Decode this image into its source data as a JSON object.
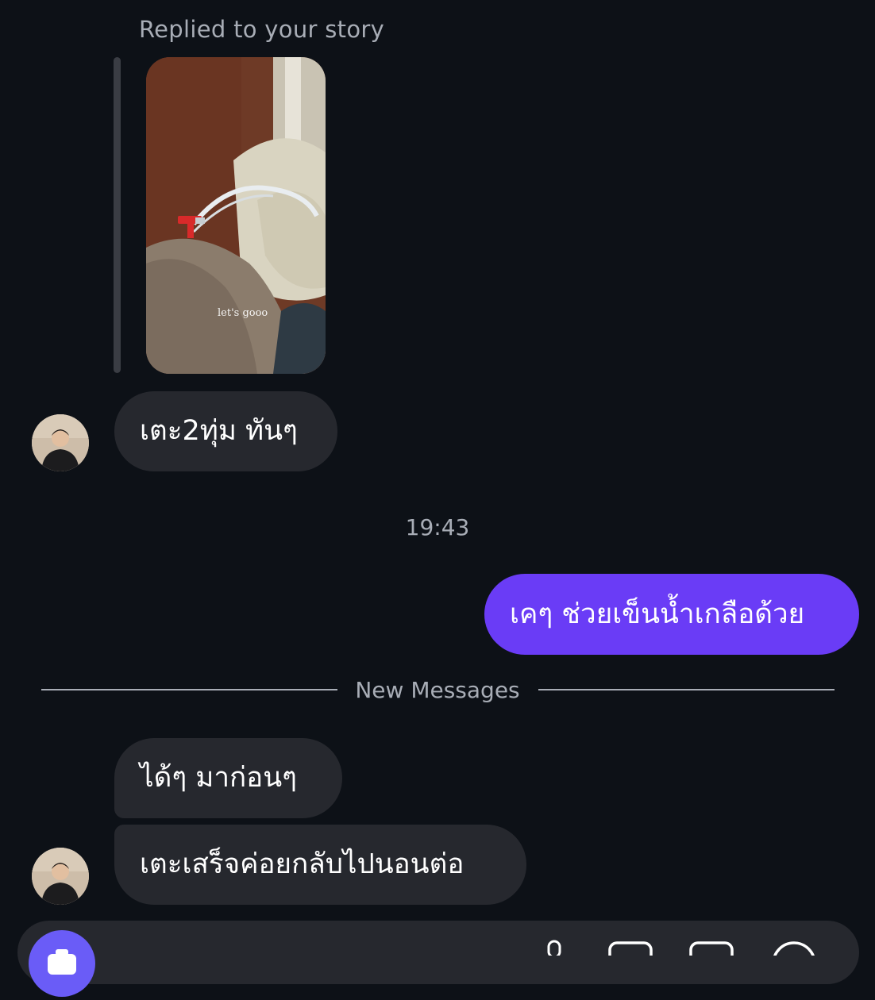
{
  "conversation": {
    "reply_label": "Replied to your story",
    "story": {
      "caption": "let's gooo"
    },
    "messages_before": [
      {
        "sender": "them",
        "text": "เตะ2ทุ่ม ทันๆ"
      }
    ],
    "timestamp": "19:43",
    "outgoing_message": "เคๆ ช่วยเข็นน้ำเกลือด้วย",
    "divider_label": "New Messages",
    "messages_after": [
      {
        "sender": "them",
        "text": "ได้ๆ มาก่อนๆ"
      },
      {
        "sender": "them",
        "text": "เตะเสร็จค่อยกลับไปนอนต่อ"
      }
    ]
  },
  "composer": {
    "camera_icon": "camera-icon",
    "icons": [
      "microphone-icon",
      "image-icon",
      "sticker-icon",
      "add-circle-icon"
    ]
  },
  "colors": {
    "background": "#0d1117",
    "incoming_bubble": "#26282e",
    "outgoing_bubble": "#6a3cf6",
    "secondary_text": "#a8adb6",
    "camera_button": "#6a5cf7"
  }
}
